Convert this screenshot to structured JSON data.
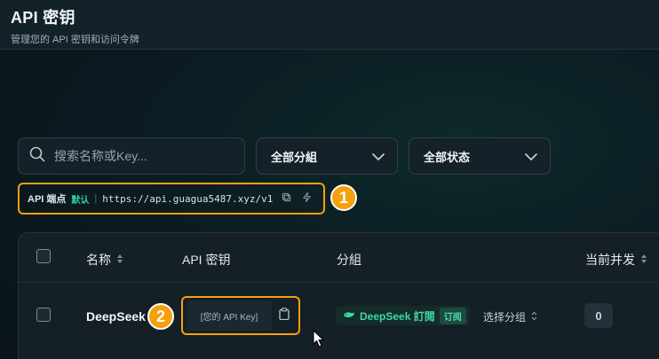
{
  "header": {
    "title": "API 密钥",
    "subtitle": "管理您的 API 密钥和访问令牌"
  },
  "filters": {
    "search_placeholder": "搜索名称或Key...",
    "group_select": "全部分組",
    "status_select": "全部状态"
  },
  "endpoint": {
    "label": "API 端点",
    "default_tag": "默认",
    "url": "https://api.guagua5487.xyz/v1"
  },
  "annotations": [
    "1",
    "2"
  ],
  "table": {
    "columns": [
      "名称",
      "API 密钥",
      "分組",
      "当前并发"
    ],
    "rows": [
      {
        "name": "DeepSeek",
        "api_key": "[您的 API Key]",
        "group": "DeepSeek 訂閱",
        "group_tag": "订阅",
        "group_action": "选择分组",
        "concurrency": "0"
      }
    ]
  },
  "colors": {
    "accent_orange": "#f5a00c",
    "accent_green": "#2fd39c"
  }
}
